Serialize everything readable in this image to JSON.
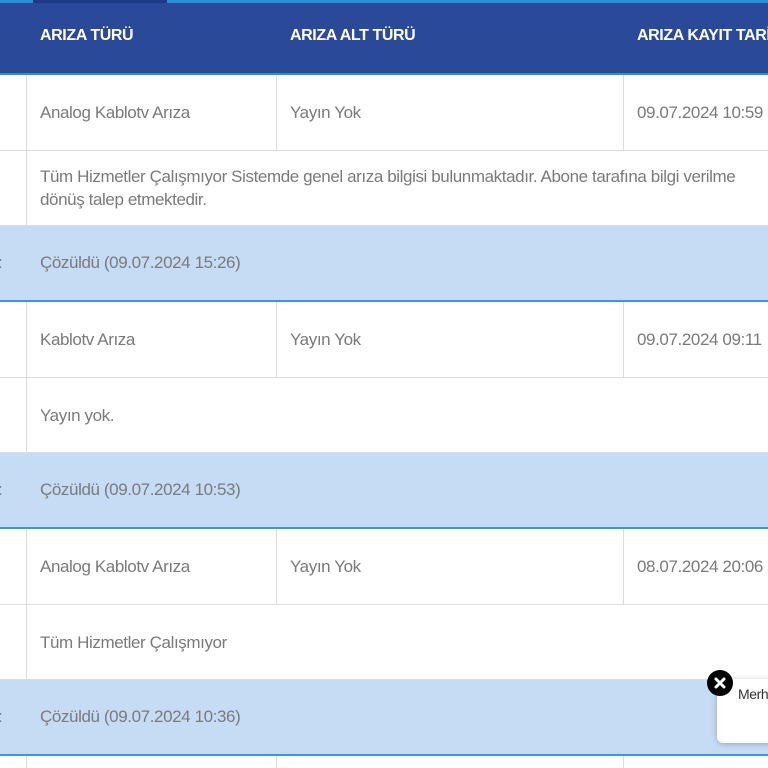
{
  "table": {
    "headers": {
      "ariza_turu": "ARIZA TÜRÜ",
      "ariza_alt_turu": "ARIZA ALT TÜRÜ",
      "ariza_kayit_tarihi": "ARIZA KAYIT TARİ"
    },
    "records": [
      {
        "ariza_turu": "Analog Kablotv Arıza",
        "ariza_alt_turu": "Yayın Yok",
        "kayit_tarihi": "09.07.2024 10:59",
        "description_line1": "Tüm Hizmetler Çalışmıyor Sistemde genel arıza bilgisi bulunmaktadır. Abone tarafına bilgi verilme",
        "description_line2": "dönüş talep etmektedir.",
        "status_colon": ":",
        "status": "Çözüldü  (09.07.2024 15:26)"
      },
      {
        "ariza_turu": "Kablotv Arıza",
        "ariza_alt_turu": "Yayın Yok",
        "kayit_tarihi": "09.07.2024 09:11",
        "description_line1": "Yayın yok.",
        "description_line2": "",
        "status_colon": ":",
        "status": "Çözüldü  (09.07.2024 10:53)"
      },
      {
        "ariza_turu": "Analog Kablotv Arıza",
        "ariza_alt_turu": "Yayın Yok",
        "kayit_tarihi": "08.07.2024 20:06",
        "description_line1": "Tüm Hizmetler Çalışmıyor",
        "description_line2": "",
        "status_colon": ":",
        "status": "Çözüldü  (09.07.2024 10:36)"
      }
    ]
  },
  "chat_widget": {
    "greeting": "Merh",
    "close_icon": "close-icon"
  },
  "colors": {
    "header_bg": "#2a4998",
    "status_row_bg": "#c6dcf5",
    "accent": "#2a8fd6"
  }
}
